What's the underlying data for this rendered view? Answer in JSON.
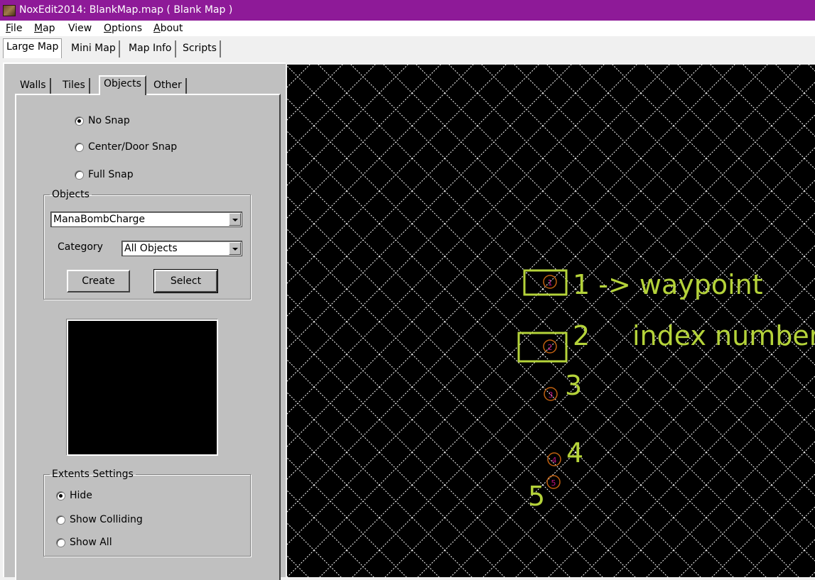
{
  "window": {
    "title": "NoxEdit2014: BlankMap.map ( Blank Map )"
  },
  "menu": [
    {
      "label": "File",
      "mnemonic": "F",
      "rest": "ile"
    },
    {
      "label": "Map",
      "mnemonic": "M",
      "rest": "ap"
    },
    {
      "label": "View",
      "mnemonic": "",
      "rest": "View"
    },
    {
      "label": "Options",
      "mnemonic": "O",
      "rest": "ptions"
    },
    {
      "label": "About",
      "mnemonic": "A",
      "rest": "bout"
    }
  ],
  "main_tabs": [
    "Large Map",
    "Mini Map",
    "Map Info",
    "Scripts"
  ],
  "panel_tabs": [
    "Walls",
    "Tiles",
    "Objects",
    "Other"
  ],
  "snap": {
    "options": [
      "No Snap",
      "Center/Door Snap",
      "Full Snap"
    ],
    "selected": "No Snap"
  },
  "objects": {
    "group_label": "Objects",
    "object_value": "ManaBombCharge",
    "category_label": "Category",
    "category_value": "All Objects",
    "create_label": "Create",
    "select_label": "Select"
  },
  "extents": {
    "group_label": "Extents Settings",
    "options": [
      "Hide",
      "Show Colliding",
      "Show All"
    ],
    "selected": "Hide"
  },
  "map": {
    "waypoints": [
      "1",
      "2",
      "3",
      "4",
      "5"
    ],
    "annotations": {
      "label1": "1 -> waypoint",
      "label2": "2",
      "index_text": "index number",
      "label3": "3",
      "label4": "4",
      "label5": "5"
    },
    "colors": {
      "grid": "#ffffff",
      "background": "#000000",
      "annotation": "#b5d33a",
      "waypoint": "#c06010"
    }
  }
}
